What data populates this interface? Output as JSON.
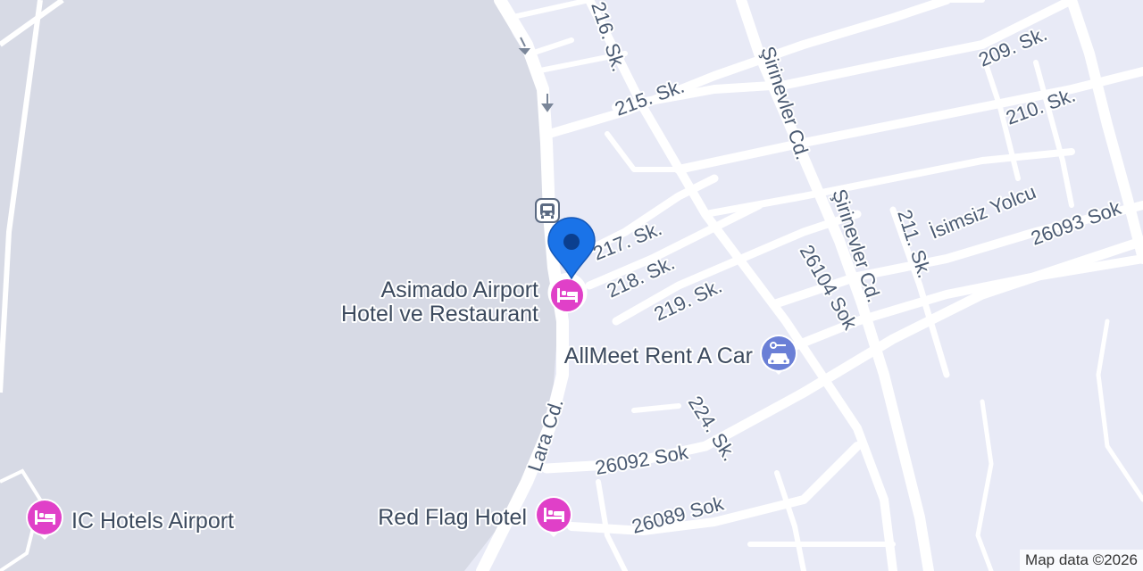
{
  "map": {
    "streets": {
      "s216": "216. Sk.",
      "s215": "215. Sk.",
      "s209": "209. Sk.",
      "s210": "210. Sk.",
      "sirinevler1": "Şirinevler Cd.",
      "sirinevler2": "Şirinevler Cd.",
      "isimsiz": "İsimsiz Yolcu",
      "s26093": "26093 Sok",
      "s211": "211. Sk.",
      "s217": "217. Sk.",
      "s218": "218. Sk.",
      "s219": "219. Sk.",
      "s26104": "26104 Sok",
      "lara": "Lara Cd.",
      "s224": "224. Sk.",
      "s26092": "26092 Sok",
      "s26089": "26089 Sok"
    },
    "pois": {
      "asimado_line1": "Asimado Airport",
      "asimado_line2": "Hotel ve Restaurant",
      "allmeet": "AllMeet Rent A Car",
      "ichotels": "IC Hotels Airport",
      "redflag": "Red Flag Hotel"
    },
    "icons": {
      "hotel": "hotel-bed-icon",
      "car_rental": "car-rental-icon",
      "bus": "bus-stop-icon",
      "marker": "location-pin-icon"
    },
    "colors": {
      "hotel": "#e040c8",
      "car_rental": "#6a7fd6",
      "marker": "#1a73e8",
      "land": "#e8eaf6",
      "airport": "#d7dae5",
      "road": "#ffffff"
    },
    "attribution": "Map data ©2026"
  }
}
